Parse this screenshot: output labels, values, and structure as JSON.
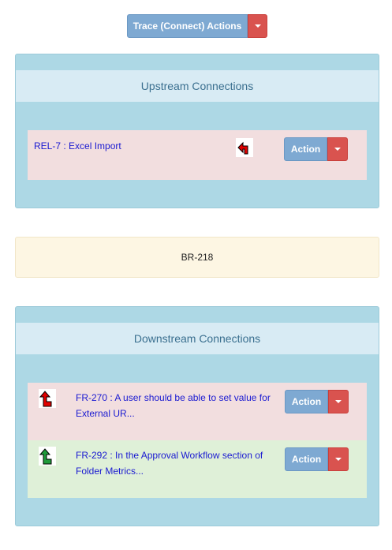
{
  "top_button": {
    "label": "Trace (Connect) Actions"
  },
  "upstream": {
    "heading": "Upstream Connections",
    "items": [
      {
        "link": "REL-7 : Excel Import",
        "action_label": "Action",
        "icon": "arrow-up-left-red-icon"
      }
    ]
  },
  "current_item": {
    "label": "BR-218"
  },
  "downstream": {
    "heading": "Downstream Connections",
    "items": [
      {
        "link": "FR-270 : A user should be able to set value for External UR...",
        "action_label": "Action",
        "icon": "arrow-up-right-red-icon"
      },
      {
        "link": "FR-292 : In the Approval Workflow section of Folder Metrics...",
        "action_label": "Action",
        "icon": "arrow-up-right-green-icon"
      }
    ]
  },
  "colors": {
    "panel_bg": "#add8e5",
    "heading_bg": "#d8ebf4",
    "row_red": "#f2dedf",
    "row_green": "#dff0d8",
    "button_blue": "#7ea9d2",
    "button_red": "#d9534f"
  }
}
